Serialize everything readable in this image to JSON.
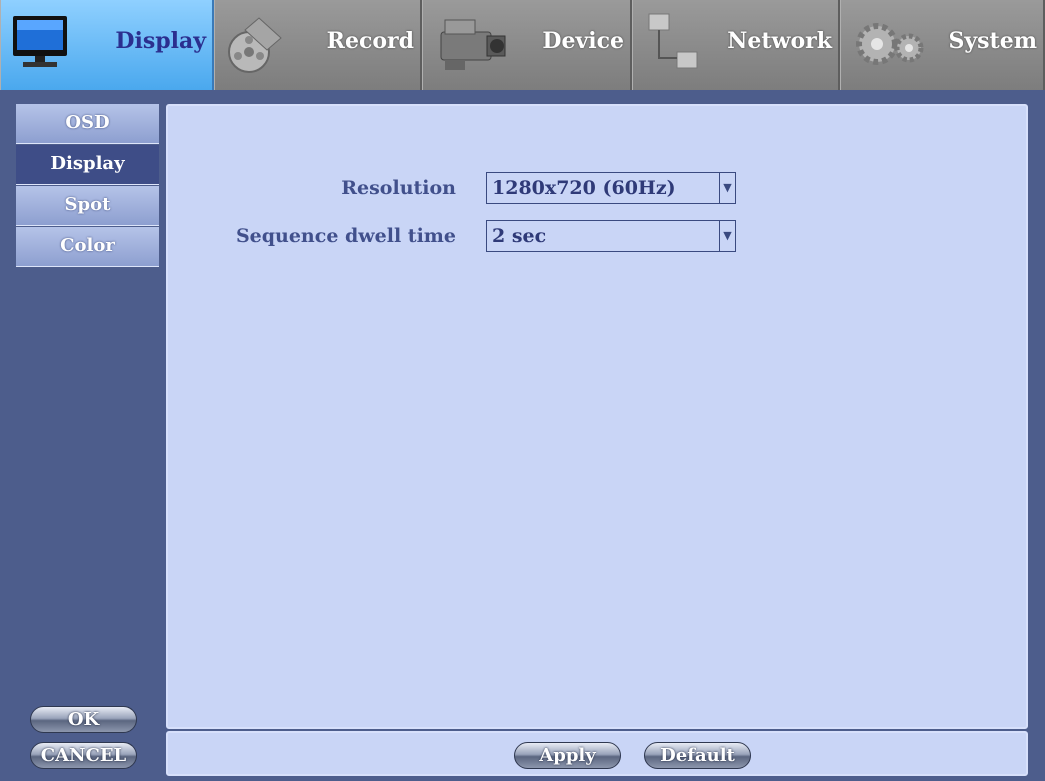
{
  "tabs": [
    {
      "label": "Display",
      "icon": "monitor-icon",
      "active": true
    },
    {
      "label": "Record",
      "icon": "film-reel-icon",
      "active": false
    },
    {
      "label": "Device",
      "icon": "camcorder-icon",
      "active": false
    },
    {
      "label": "Network",
      "icon": "network-icon",
      "active": false
    },
    {
      "label": "System",
      "icon": "gears-icon",
      "active": false
    }
  ],
  "sidebar": {
    "items": [
      {
        "label": "OSD"
      },
      {
        "label": "Display"
      },
      {
        "label": "Spot"
      },
      {
        "label": "Color"
      }
    ],
    "active_index": 1,
    "ok_label": "OK",
    "cancel_label": "CANCEL"
  },
  "form": {
    "resolution_label": "Resolution",
    "resolution_value": "1280x720 (60Hz)",
    "dwell_label": "Sequence dwell time",
    "dwell_value": "2 sec"
  },
  "footer": {
    "apply_label": "Apply",
    "default_label": "Default"
  },
  "colors": {
    "accent_active_tab": "#4aa8ee",
    "panel_bg": "#c9d5f6",
    "sidebar_active": "#3e4d87"
  }
}
